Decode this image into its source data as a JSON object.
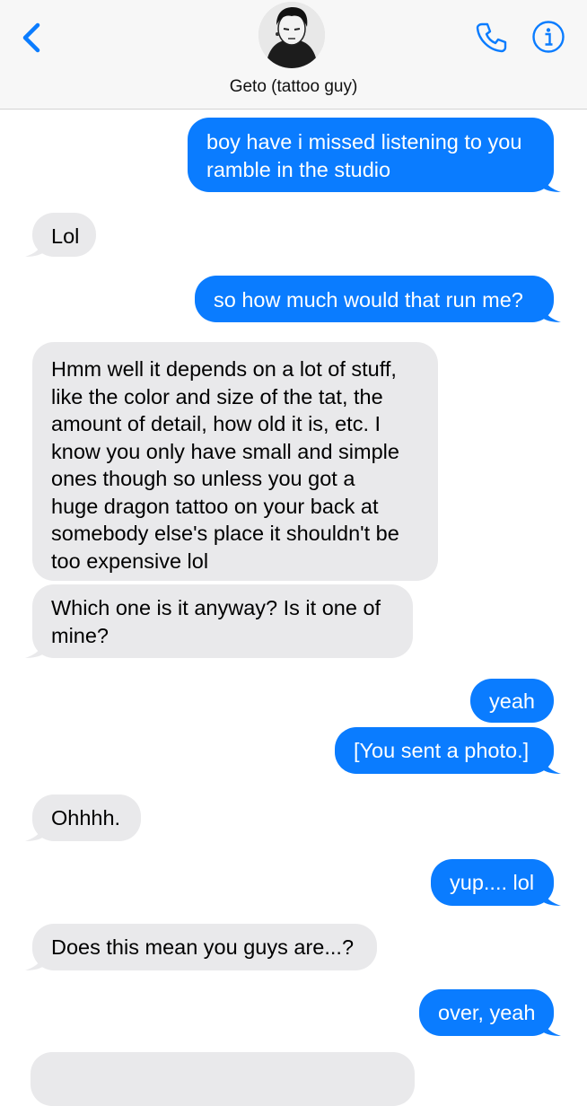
{
  "header": {
    "contact_name": "Geto (tattoo guy)",
    "back_icon": "chevron-left-icon",
    "call_icon": "phone-icon",
    "info_icon": "info-icon",
    "accent": "#0a7cff"
  },
  "messages": [
    {
      "from": "me",
      "lines": [
        "boy have i missed listening to you",
        "ramble in the studio"
      ]
    },
    {
      "from": "them",
      "lines": [
        "Lol"
      ]
    },
    {
      "from": "me",
      "lines": [
        "so how much would that run me?"
      ]
    },
    {
      "from": "them",
      "lines": [
        "Hmm well it depends on a lot of stuff,",
        "like the color and size of the tat, the",
        "amount of detail, how old it is, etc. I",
        "know you only have small and simple",
        "ones though so unless you got a",
        "huge dragon tattoo on your back at",
        "somebody else's place it shouldn't be",
        "too expensive lol"
      ]
    },
    {
      "from": "them",
      "lines": [
        "Which one is it anyway? Is it one of",
        "mine?"
      ]
    },
    {
      "from": "me",
      "lines": [
        "yeah"
      ]
    },
    {
      "from": "me",
      "lines": [
        "[You sent a photo.]"
      ]
    },
    {
      "from": "them",
      "lines": [
        "Ohhhh."
      ]
    },
    {
      "from": "me",
      "lines": [
        "yup.... lol"
      ]
    },
    {
      "from": "them",
      "lines": [
        "Does this mean you guys are...?"
      ]
    },
    {
      "from": "me",
      "lines": [
        "over, yeah"
      ]
    }
  ],
  "colors": {
    "outgoing": "#0a7cff",
    "incoming": "#e9e9eb"
  }
}
